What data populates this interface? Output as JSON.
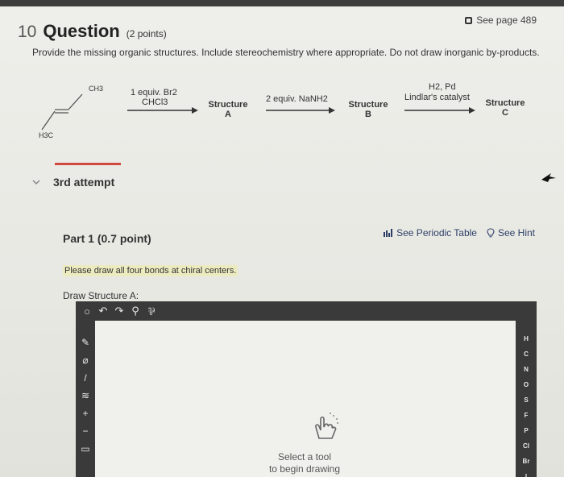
{
  "question": {
    "number": "10",
    "title": "Question",
    "points": "(2 points)",
    "page_ref": "See page 489",
    "instructions": "Provide the missing organic structures. Include stereochemistry where appropriate. Do not draw inorganic by-products."
  },
  "scheme": {
    "ch3_top": "CH3",
    "h3c_bottom": "H3C",
    "reagent1_line1": "1 equiv. Br2",
    "reagent1_line2": "CHCl3",
    "structure_a_line1": "Structure",
    "structure_a_line2": "A",
    "reagent2": "2 equiv. NaNH2",
    "structure_b_line1": "Structure",
    "structure_b_line2": "B",
    "reagent3_line1": "H2, Pd",
    "reagent3_line2": "Lindlar's catalyst",
    "structure_c_line1": "Structure",
    "structure_c_line2": "C"
  },
  "attempt": "3rd attempt",
  "part": {
    "label": "Part 1",
    "points": "(0.7 point)",
    "periodic_link": "See Periodic Table",
    "hint_link": "See Hint",
    "note": "Please draw all four bonds at chiral centers.",
    "draw_label": "Draw Structure A:"
  },
  "editor": {
    "toolbar": [
      "○",
      "↶",
      "↷",
      "⚲",
      "⅌"
    ],
    "left_tools": [
      "✎",
      "⌀",
      "/",
      "≋",
      "+",
      "−",
      "▭"
    ],
    "elements": [
      "H",
      "C",
      "N",
      "O",
      "S",
      "F",
      "P",
      "Cl",
      "Br",
      "I"
    ],
    "canvas_hint_line1": "Select a tool",
    "canvas_hint_line2": "to begin drawing"
  }
}
